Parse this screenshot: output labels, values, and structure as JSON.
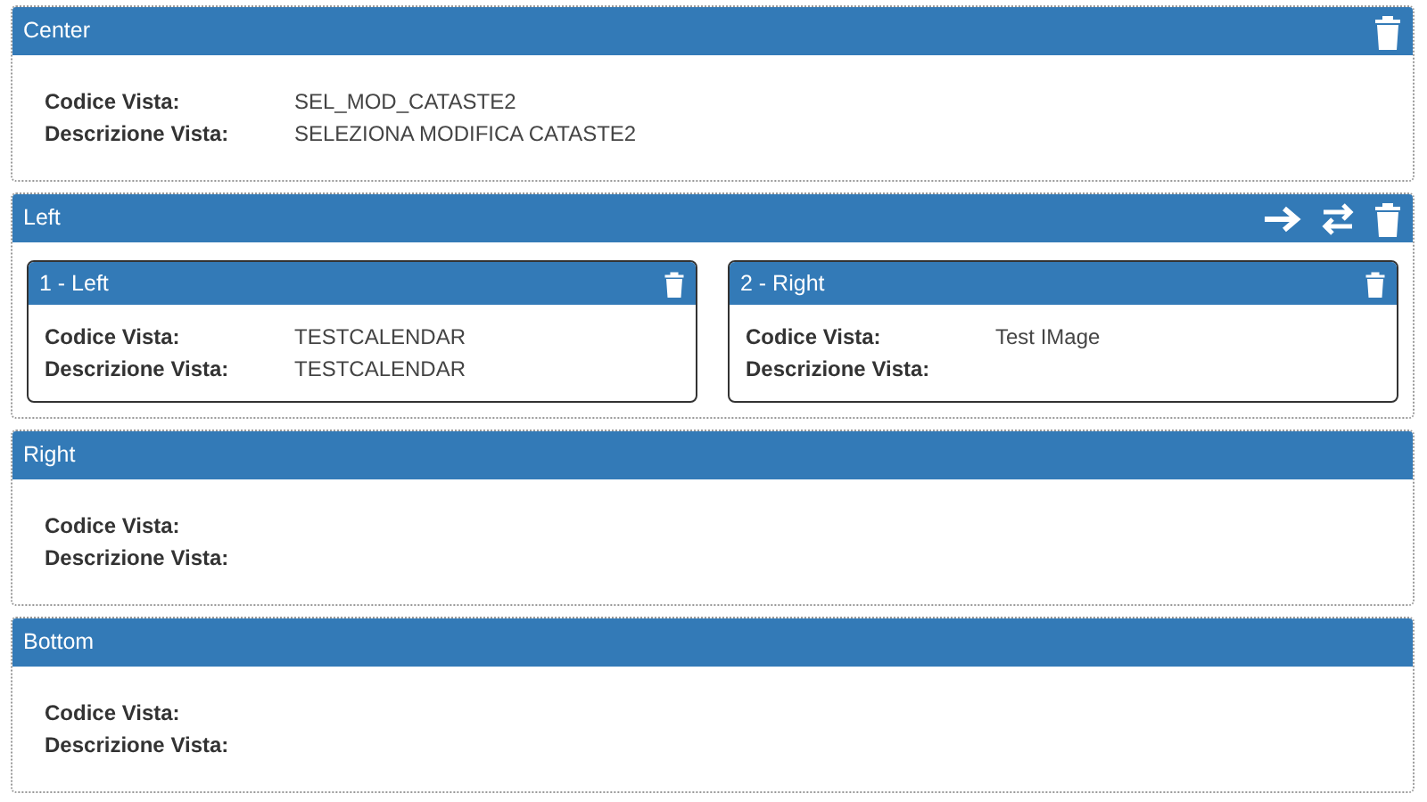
{
  "panels": [
    {
      "title": "Center",
      "kind": "single",
      "actions": [
        {
          "kind": "delete"
        }
      ],
      "fields": [
        {
          "label": "Codice Vista:",
          "value": "SEL_MOD_CATASTE2"
        },
        {
          "label": "Descrizione Vista:",
          "value": "SELEZIONA MODIFICA CATASTE2"
        }
      ]
    },
    {
      "title": "Left",
      "kind": "split",
      "actions": [
        {
          "kind": "arrow"
        },
        {
          "kind": "swap"
        },
        {
          "kind": "delete"
        }
      ],
      "subpanels": [
        {
          "title": "1 - Left",
          "fields": [
            {
              "label": "Codice Vista:",
              "value": "TESTCALENDAR"
            },
            {
              "label": "Descrizione Vista:",
              "value": "TESTCALENDAR"
            }
          ]
        },
        {
          "title": "2 - Right",
          "fields": [
            {
              "label": "Codice Vista:",
              "value": "Test IMage"
            },
            {
              "label": "Descrizione Vista:"
            }
          ]
        }
      ]
    },
    {
      "title": "Right",
      "kind": "single",
      "fields": [
        {
          "label": "Codice Vista:"
        },
        {
          "label": "Descrizione Vista:"
        }
      ]
    },
    {
      "title": "Bottom",
      "kind": "single",
      "fields": [
        {
          "label": "Codice Vista:"
        },
        {
          "label": "Descrizione Vista:"
        }
      ]
    }
  ]
}
